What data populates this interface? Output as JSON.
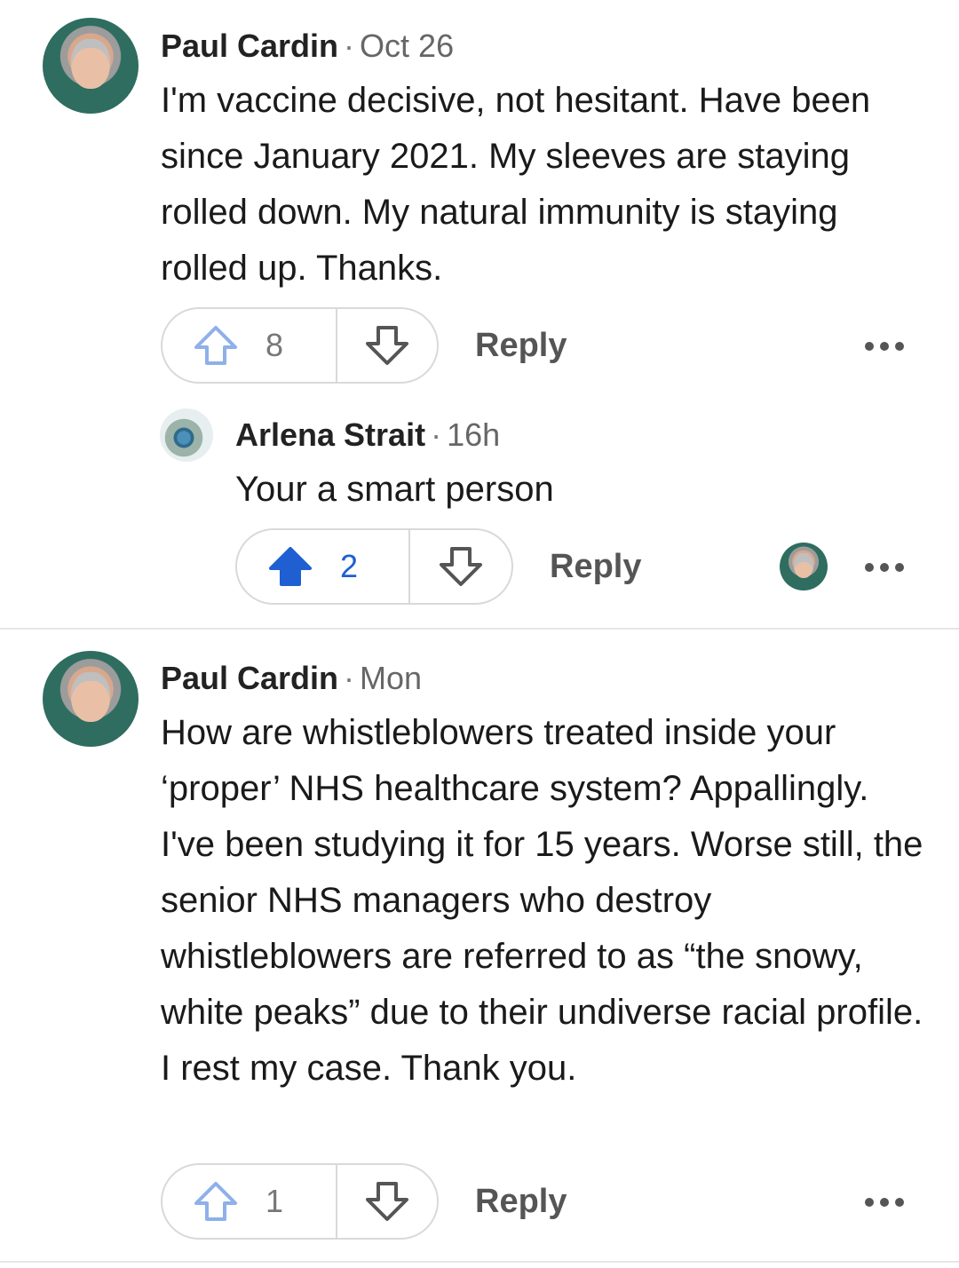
{
  "comments": [
    {
      "author": "Paul Cardin",
      "separator": "·",
      "time": "Oct 26",
      "text": "I'm vaccine decisive, not hesitant. Have been since January 2021. My sleeves are staying rolled down. My natural immunity is staying rolled up. Thanks.",
      "upvotes": "8",
      "reply_label": "Reply"
    },
    {
      "author": "Arlena Strait",
      "separator": "·",
      "time": "16h",
      "text": "Your a smart person",
      "upvotes": "2",
      "reply_label": "Reply"
    },
    {
      "author": "Paul Cardin",
      "separator": "·",
      "time": "Mon",
      "text": "How are whistleblowers treated inside your ‘proper’ NHS healthcare system? Appallingly. I've been studying it for 15 years. Worse still, the senior NHS managers who destroy whistleblowers are referred to as “the snowy, white peaks” due to their undiverse racial profile. I rest my case. Thank you.",
      "upvotes": "1",
      "reply_label": "Reply"
    }
  ],
  "icons": {
    "upvote": "arrow-up-icon",
    "downvote": "arrow-down-icon",
    "more": "more-options-icon"
  },
  "colors": {
    "upvote_active": "#1f5fd1",
    "upvote_inactive": "#8fb0e8",
    "muted_text": "#666666"
  }
}
